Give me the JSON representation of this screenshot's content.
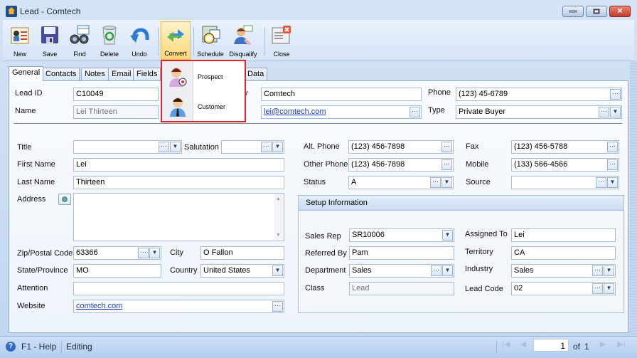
{
  "window": {
    "title": "Lead - Comtech",
    "controls": [
      "minimize",
      "maximize",
      "close"
    ]
  },
  "toolbar": {
    "buttons": [
      {
        "label": "New",
        "icon": "new-lead-icon"
      },
      {
        "label": "Save",
        "icon": "floppy-disk-icon"
      },
      {
        "label": "Find",
        "icon": "binoculars-icon"
      },
      {
        "label": "Delete",
        "icon": "recycle-bin-icon"
      },
      {
        "label": "Undo",
        "icon": "undo-arrow-icon"
      },
      {
        "label": "Convert",
        "icon": "convert-arrows-icon",
        "active": true
      },
      {
        "label": "Schedule",
        "icon": "schedule-clock-icon"
      },
      {
        "label": "Disqualify",
        "icon": "disqualify-person-icon"
      },
      {
        "label": "Close",
        "icon": "close-window-icon"
      }
    ]
  },
  "convert_menu": {
    "items": [
      {
        "label": "Prospect",
        "icon": "prospect-person-icon"
      },
      {
        "label": "Customer",
        "icon": "customer-person-icon"
      }
    ]
  },
  "tabs": [
    {
      "label": "General",
      "selected": true
    },
    {
      "label": "Contacts"
    },
    {
      "label": "Notes"
    },
    {
      "label": "Email"
    },
    {
      "label": "Fields"
    },
    {
      "label": "Data"
    }
  ],
  "header": {
    "lead_id_label": "Lead ID",
    "lead_id": "C10049",
    "name_label": "Name",
    "name": "Lei Thirteen",
    "company_label_partial": "y",
    "company": "Comtech",
    "email": "lei@comtech.com",
    "phone_label": "Phone",
    "phone": "(123) 45-6789",
    "type_label": "Type",
    "type": "Private Buyer"
  },
  "contact": {
    "title_label": "Title",
    "title": "",
    "salutation_label": "Salutation",
    "salutation": "",
    "first_name_label": "First Name",
    "first_name": "Lei",
    "last_name_label": "Last Name",
    "last_name": "Thirteen",
    "address_label": "Address",
    "address": "",
    "zip_label": "Zip/Postal Code",
    "zip": "63366",
    "city_label": "City",
    "city": "O Fallon",
    "state_label": "State/Province",
    "state": "MO",
    "country_label": "Country",
    "country": "United States",
    "attention_label": "Attention",
    "attention": "",
    "website_label": "Website",
    "website": "comtech.com"
  },
  "phones": {
    "alt_phone_label": "Alt. Phone",
    "alt_phone": "(123) 456-7898",
    "fax_label": "Fax",
    "fax": "(123) 456-5788",
    "other_phone_label": "Other Phone",
    "other_phone": "(123) 456-7898",
    "mobile_label": "Mobile",
    "mobile": "(133) 566-4566",
    "status_label": "Status",
    "status": "A",
    "source_label": "Source",
    "source": ""
  },
  "setup": {
    "title": "Setup Information",
    "sales_rep_label": "Sales Rep",
    "sales_rep": "SR10006",
    "assigned_to_label": "Assigned To",
    "assigned_to": "Lei",
    "referred_by_label": "Referred By",
    "referred_by": "Pam",
    "territory_label": "Territory",
    "territory": "CA",
    "department_label": "Department",
    "department": "Sales",
    "industry_label": "Industry",
    "industry": "Sales",
    "class_label": "Class",
    "class": "Lead",
    "lead_code_label": "Lead Code",
    "lead_code": "02"
  },
  "statusbar": {
    "help": "F1 - Help",
    "mode": "Editing",
    "page": "1",
    "of_label": "of",
    "total": "1"
  },
  "colors": {
    "accent_red": "#e0242c",
    "link": "#1a3fb8"
  }
}
